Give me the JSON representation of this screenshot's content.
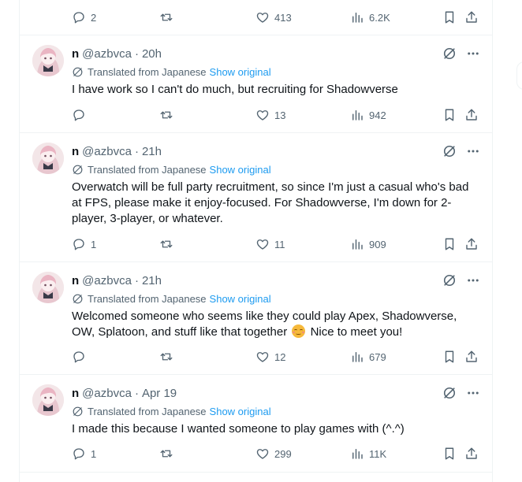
{
  "top_actions": {
    "replies": "2",
    "retweets": "",
    "likes": "413",
    "views": "6.2K"
  },
  "tweets": [
    {
      "name": "n",
      "handle": "@azbvca",
      "dot": "·",
      "time": "20h",
      "translated_label": "Translated from Japanese",
      "show_original": "Show original",
      "text": "I have work so I can't do much, but recruiting for Shadowverse",
      "replies": "",
      "retweets": "",
      "likes": "13",
      "views": "942"
    },
    {
      "name": "n",
      "handle": "@azbvca",
      "dot": "·",
      "time": "21h",
      "translated_label": "Translated from Japanese",
      "show_original": "Show original",
      "text": "Overwatch will be full party recruitment, so since I'm just a casual who's bad at FPS, please make it enjoy-focused. For Shadowverse, I'm down for 2-player, 3-player, or whatever.",
      "replies": "1",
      "retweets": "",
      "likes": "11",
      "views": "909"
    },
    {
      "name": "n",
      "handle": "@azbvca",
      "dot": "·",
      "time": "21h",
      "translated_label": "Translated from Japanese",
      "show_original": "Show original",
      "text_before_emoji": "Welcomed someone who seems like they could play Apex, Shadowverse, OW, Splatoon, and stuff like that together",
      "text_after_emoji": "Nice to meet you!",
      "replies": "",
      "retweets": "",
      "likes": "12",
      "views": "679"
    },
    {
      "name": "n",
      "handle": "@azbvca",
      "dot": "·",
      "time": "Apr 19",
      "translated_label": "Translated from Japanese",
      "show_original": "Show original",
      "text": "I made this because I wanted someone to play games with (^.^)",
      "replies": "1",
      "retweets": "",
      "likes": "299",
      "views": "11K"
    }
  ],
  "icons": {
    "reply": "reply-icon",
    "retweet": "retweet-icon",
    "like": "heart-icon",
    "views": "views-chart-icon",
    "bookmark": "bookmark-icon",
    "share": "share-icon",
    "translate": "translate-globe-icon",
    "grok": "grok-icon",
    "more": "more-icon",
    "emoji": "smiling-face-emoji"
  },
  "colors": {
    "text": "#0f1419",
    "muted": "#536471",
    "link": "#1d9bf0",
    "border": "#eff3f4"
  }
}
